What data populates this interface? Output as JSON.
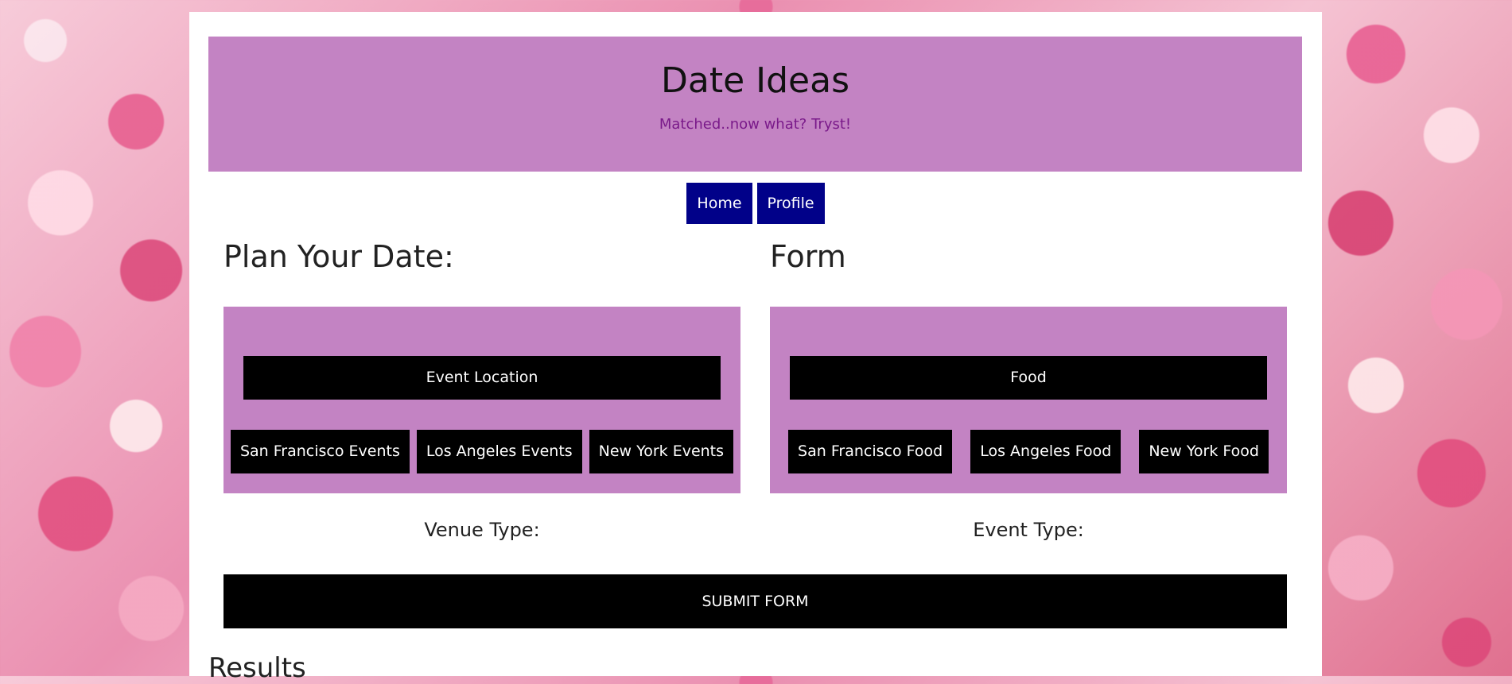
{
  "header": {
    "title": "Date Ideas",
    "tagline": "Matched..now what? Tryst!"
  },
  "nav": {
    "items": [
      {
        "label": "Home"
      },
      {
        "label": "Profile"
      }
    ]
  },
  "left_column": {
    "title": "Plan Your Date:",
    "bar_label": "Event Location",
    "buttons": [
      "San Francisco Events",
      "Los Angeles Events",
      "New York Events"
    ],
    "type_label": "Venue Type:"
  },
  "right_column": {
    "title": "Form",
    "bar_label": "Food",
    "buttons": [
      "San Francisco Food",
      "Los Angeles Food",
      "New York Food"
    ],
    "type_label": "Event Type:"
  },
  "submit_label": "SUBMIT FORM",
  "results_title": "Results",
  "colors": {
    "panel": "#c383c3",
    "nav_button": "#010189",
    "button": "#000000",
    "tagline": "#7a1a8a"
  }
}
